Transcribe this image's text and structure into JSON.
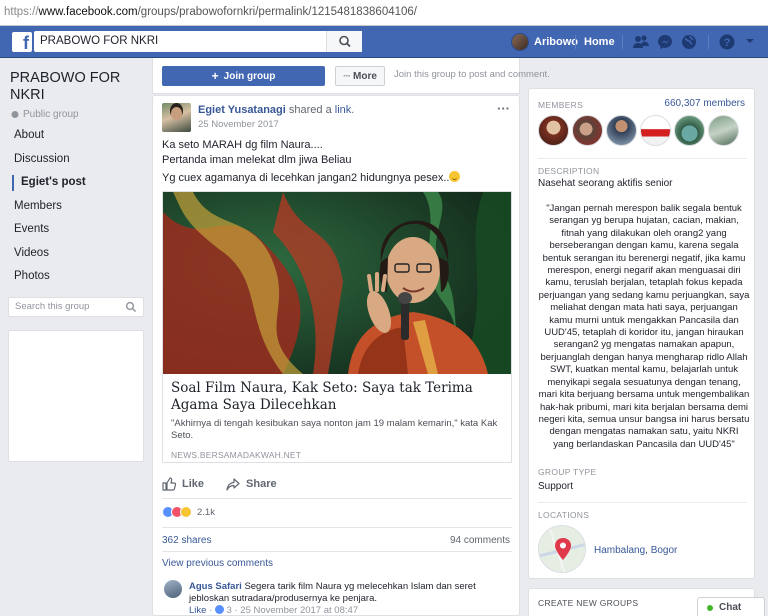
{
  "browser": {
    "url_scheme": "https://",
    "url_host": "www.facebook.com",
    "url_path": "/groups/prabowofornkri/permalink/1215481838604106/"
  },
  "topnav": {
    "logo": "f",
    "search_value": "PRABOWO FOR NKRI",
    "user_name": "Aribowo",
    "home_label": "Home",
    "accent_color": "#4267b2"
  },
  "group": {
    "name": "PRABOWO FOR NKRI",
    "privacy": "Public group",
    "nav": [
      {
        "label": "About"
      },
      {
        "label": "Discussion"
      },
      {
        "label": "Egiet's post"
      },
      {
        "label": "Members"
      },
      {
        "label": "Events"
      },
      {
        "label": "Videos"
      },
      {
        "label": "Photos"
      }
    ],
    "search_placeholder": "Search this group"
  },
  "joinbar": {
    "join_label": "Join group",
    "more_label": "More",
    "hint": "Join this group to post and comment."
  },
  "post": {
    "author": "Egiet Yusatanagi",
    "verb": "shared a",
    "link_word": "link",
    "date": "25 November 2017",
    "lines": [
      "Ka seto MARAH dg film Naura....",
      "Pertanda iman melekat dlm jiwa Beliau",
      "Yg cuex agamanya di lecehkan jangan2 hidungnya pesex.."
    ],
    "link_title": "Soal Film Naura, Kak Seto: Saya tak Terima Agama Saya Dilecehkan",
    "link_desc": "\"Akhirnya di tengah kesibukan saya nonton jam 19 malam kemarin,\" kata Kak Seto.",
    "link_domain": "NEWS.BERSAMADAKWAH.NET",
    "like_label": "Like",
    "share_label": "Share",
    "reaction_count": "2.1k",
    "shares": "362 shares",
    "comments": "94 comments",
    "view_previous": "View previous comments",
    "comment": {
      "author": "Agus Safari",
      "text": "Segera tarik film Naura yg melecehkan Islam dan seret jebloskan sutradara/produsernya ke penjara.",
      "like": "Like",
      "sep": " · ",
      "reactions": "3",
      "date": "25 November 2017 at 08:47"
    }
  },
  "sidebar": {
    "members_label": "MEMBERS",
    "members_count": "660,307 members",
    "description_label": "DESCRIPTION",
    "description": "Nasehat seorang aktifis senior",
    "quote": "\"Jangan pernah merespon balik segala bentuk serangan yg berupa hujatan, cacian, makian, fitnah yang dilakukan oleh orang2 yang berseberangan dengan kamu, karena segala bentuk serangan itu berenergi negatif, jika kamu merespon, energi negarif akan menguasai diri kamu, teruslah berjalan, tetaplah fokus kepada perjuangan yang sedang kamu perjuangkan, saya meliahat dengan mata hati saya, perjuangan kamu murni untuk mengakkan Pancasila dan UUD'45, tetaplah di koridor itu, jangan hiraukan serangan2 yg mengatas namakan apapun, berjuanglah dengan hanya mengharap ridlo Allah SWT, kuatkan mental kamu, belajarlah untuk menyikapi segala sesuatunya dengan tenang, mari kita berjuang bersama untuk mengembalikan hak-hak pribumi, mari kita berjalan bersama demi negeri kita, semua unsur bangsa ini harus bersatu dengan mengatas namakan satu, yaitu NKRI yang berlandaskan Pancasila dan UUD'45\"",
    "group_type_label": "GROUP TYPE",
    "group_type": "Support",
    "locations_label": "LOCATIONS",
    "location": "Hambalang, Bogor",
    "create_label": "CREATE NEW GROUPS"
  },
  "chat": {
    "label": "Chat"
  }
}
